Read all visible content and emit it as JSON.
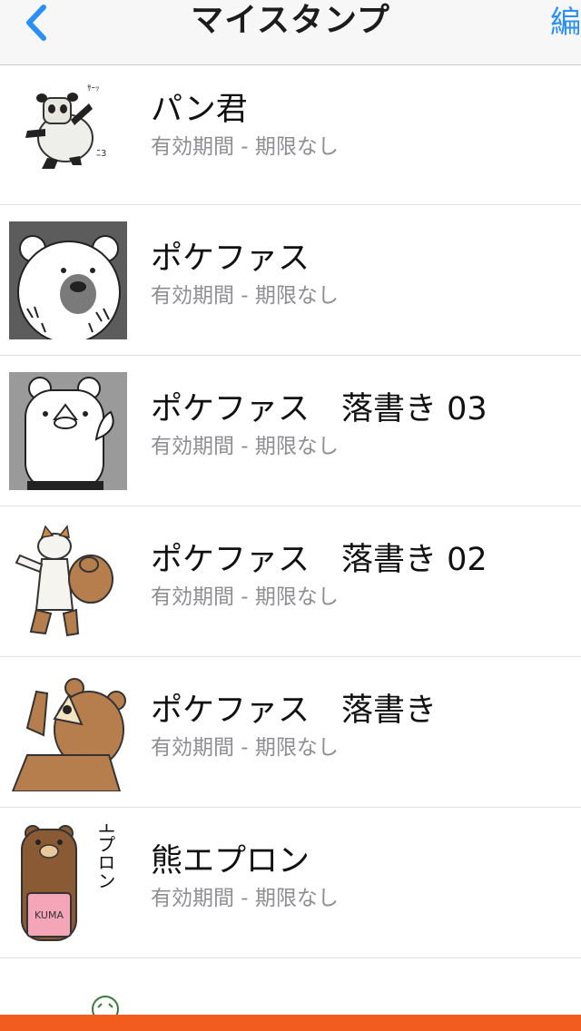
{
  "nav": {
    "title": "マイスタンプ",
    "back_icon": "chevron-left-icon",
    "edit_label": "編"
  },
  "colors": {
    "accent": "#2a8ff7",
    "bottom_bar": "#f25c1f",
    "subtitle": "#8e8e93"
  },
  "stickers": [
    {
      "title": "パン君",
      "subtitle": "有効期間 - 期限なし",
      "thumb": "panda-sticker-thumbnail"
    },
    {
      "title": "ポケファス",
      "subtitle": "有効期間 - 期限なし",
      "thumb": "polar-bear-sticker-thumbnail"
    },
    {
      "title": "ポケファス　落書き 03",
      "subtitle": "有効期間 - 期限なし",
      "thumb": "white-bear-sticker-thumbnail"
    },
    {
      "title": "ポケファス　落書き 02",
      "subtitle": "有効期間 - 期限なし",
      "thumb": "dog-and-bear-sticker-thumbnail"
    },
    {
      "title": "ポケファス　落書き",
      "subtitle": "有効期間 - 期限なし",
      "thumb": "brown-bear-sticker-thumbnail"
    },
    {
      "title": "熊エプロン",
      "subtitle": "有効期間 - 期限なし",
      "thumb": "apron-bear-sticker-thumbnail",
      "thumb_text": "熊エプロン",
      "apron_text": "KUMA"
    }
  ]
}
